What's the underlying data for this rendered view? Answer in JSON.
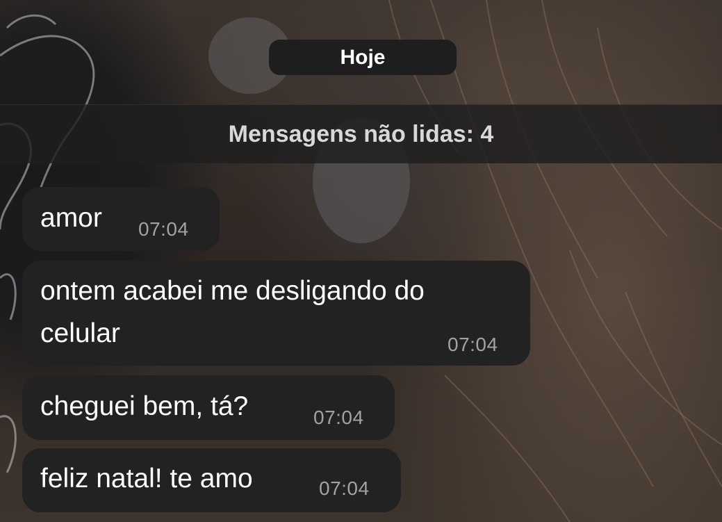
{
  "date_separator": "Hoje",
  "unread_banner": "Mensagens não lidas: 4",
  "messages": [
    {
      "lines": [
        "amor"
      ],
      "time": "07:04"
    },
    {
      "lines": [
        "ontem acabei me desligando do",
        "celular"
      ],
      "time": "07:04"
    },
    {
      "lines": [
        "cheguei bem, tá?"
      ],
      "time": "07:04"
    },
    {
      "lines": [
        "feliz natal! te amo"
      ],
      "time": "07:04"
    }
  ]
}
